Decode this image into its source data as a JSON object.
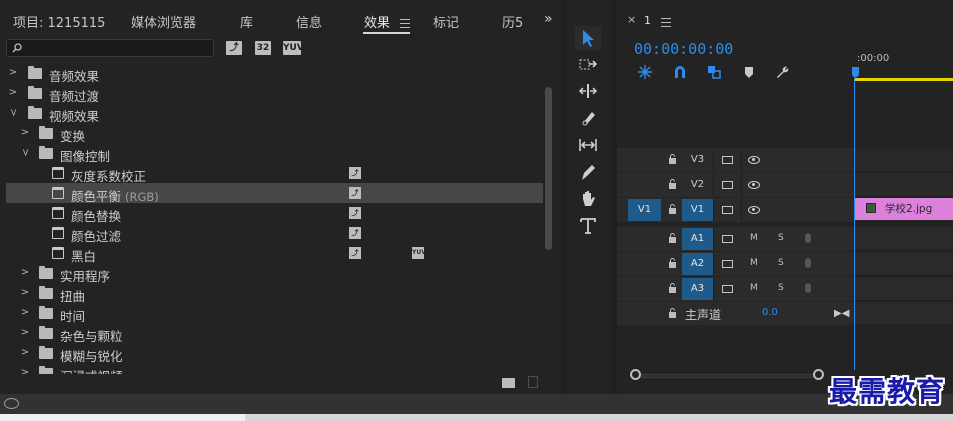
{
  "effects_panel": {
    "tabs": [
      {
        "label": "项目: 1215115"
      },
      {
        "label": "媒体浏览器"
      },
      {
        "label": "库"
      },
      {
        "label": "信息"
      },
      {
        "label": "效果",
        "active": true
      },
      {
        "label": "标记"
      },
      {
        "label": "历5"
      }
    ],
    "overflow_icon": "»",
    "search": {
      "value": "",
      "placeholder": ""
    },
    "filter_buttons": [
      "32",
      "YUV"
    ],
    "tree": [
      {
        "depth": 0,
        "expanded": false,
        "type": "folder",
        "label": "音频效果"
      },
      {
        "depth": 0,
        "expanded": false,
        "type": "folder",
        "label": "音频过渡"
      },
      {
        "depth": 0,
        "expanded": true,
        "type": "folder",
        "label": "视频效果"
      },
      {
        "depth": 1,
        "expanded": false,
        "type": "folder",
        "label": "变换"
      },
      {
        "depth": 1,
        "expanded": true,
        "type": "folder",
        "label": "图像控制"
      },
      {
        "depth": 2,
        "type": "effect",
        "label": "灰度系数校正",
        "badges": [
          "accelerated"
        ]
      },
      {
        "depth": 2,
        "type": "effect",
        "label": "颜色平衡",
        "sub": "(RGB)",
        "badges": [
          "accelerated"
        ],
        "selected": true
      },
      {
        "depth": 2,
        "type": "effect",
        "label": "颜色替换",
        "badges": [
          "accelerated"
        ]
      },
      {
        "depth": 2,
        "type": "effect",
        "label": "颜色过滤",
        "badges": [
          "accelerated"
        ]
      },
      {
        "depth": 2,
        "type": "effect",
        "label": "黑白",
        "badges": [
          "accelerated",
          "yuv"
        ]
      },
      {
        "depth": 1,
        "expanded": false,
        "type": "folder",
        "label": "实用程序"
      },
      {
        "depth": 1,
        "expanded": false,
        "type": "folder",
        "label": "扭曲"
      },
      {
        "depth": 1,
        "expanded": false,
        "type": "folder",
        "label": "时间"
      },
      {
        "depth": 1,
        "expanded": false,
        "type": "folder",
        "label": "杂色与颗粒"
      },
      {
        "depth": 1,
        "expanded": false,
        "type": "folder",
        "label": "模糊与锐化"
      },
      {
        "depth": 1,
        "expanded": false,
        "type": "folder",
        "label": "沉浸式视频"
      }
    ]
  },
  "tools": [
    {
      "name": "selection-tool",
      "active": true
    },
    {
      "name": "track-select-tool"
    },
    {
      "name": "ripple-edit-tool"
    },
    {
      "name": "razor-tool"
    },
    {
      "name": "slip-tool"
    },
    {
      "name": "pen-tool"
    },
    {
      "name": "hand-tool"
    },
    {
      "name": "type-tool"
    }
  ],
  "timeline": {
    "sequence_tab": "1",
    "close_icon": "×",
    "timecode": "00:00:00:00",
    "ruler_label": ":00:00",
    "video_tracks": [
      {
        "name": "V3",
        "source_patch": ""
      },
      {
        "name": "V2",
        "source_patch": ""
      },
      {
        "name": "V1",
        "source_patch": "V1",
        "targeted": true
      }
    ],
    "audio_tracks": [
      {
        "name": "A1",
        "targeted": true
      },
      {
        "name": "A2",
        "targeted": true
      },
      {
        "name": "A3",
        "targeted": true
      }
    ],
    "mute_label": "M",
    "solo_label": "S",
    "master": {
      "label": "主声道",
      "value": "0.0"
    },
    "clip": {
      "label": "学校2.jpg",
      "track": "V1"
    },
    "colors": {
      "accent": "#2d8ceb",
      "clip": "#dd80dc",
      "ruler": "#e6d400"
    }
  },
  "watermark": "最需教育"
}
